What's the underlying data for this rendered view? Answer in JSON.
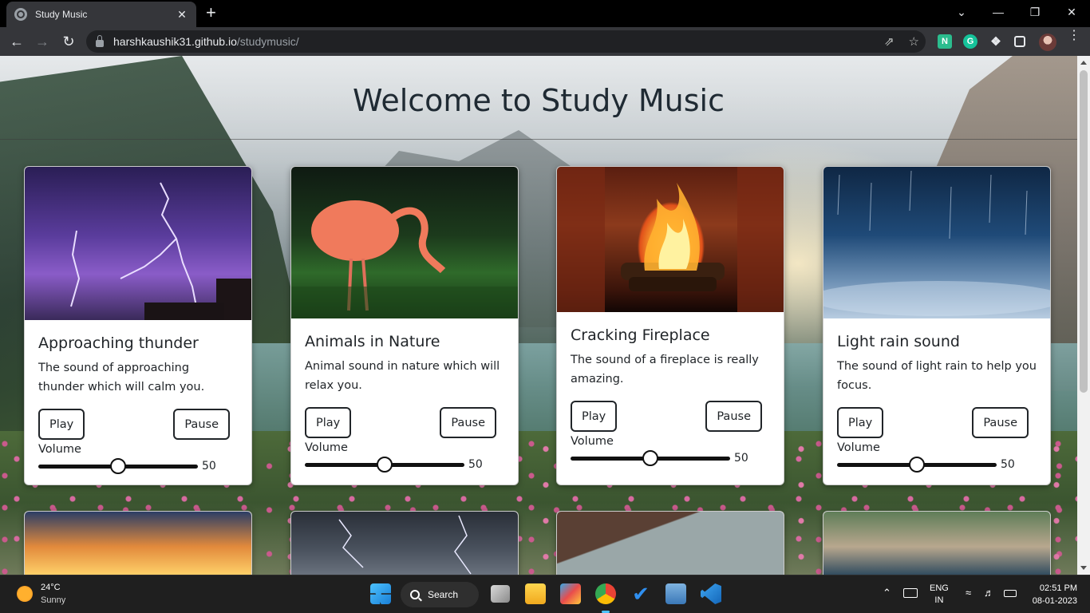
{
  "browser": {
    "tab_title": "Study Music",
    "tab_close": "✕",
    "new_tab": "+",
    "url_host": "harshkaushik31.github.io",
    "url_path": "/studymusic/",
    "extensions": [
      {
        "name": "notion-web-clipper",
        "glyph": "N",
        "color": "#2bbd8e"
      },
      {
        "name": "grammarly",
        "glyph": "G",
        "color": "#15c39a"
      }
    ]
  },
  "page": {
    "title": "Welcome to Study Music",
    "cards": [
      {
        "title": "Approaching thunder",
        "text": "The sound of approaching thunder which will calm you.",
        "play": "Play",
        "pause": "Pause",
        "volume_label": "Volume",
        "volume": 50
      },
      {
        "title": "Animals in Nature",
        "text": "Animal sound in nature which will relax you.",
        "play": "Play",
        "pause": "Pause",
        "volume_label": "Volume",
        "volume": 50
      },
      {
        "title": "Cracking Fireplace",
        "text": "The sound of a fireplace is really amazing.",
        "play": "Play",
        "pause": "Pause",
        "volume_label": "Volume",
        "volume": 50
      },
      {
        "title": "Light rain sound",
        "text": "The sound of light rain to help you focus.",
        "play": "Play",
        "pause": "Pause",
        "volume_label": "Volume",
        "volume": 50
      }
    ]
  },
  "taskbar": {
    "weather_temp": "24°C",
    "weather_desc": "Sunny",
    "search_label": "Search",
    "lang_top": "ENG",
    "lang_bottom": "IN",
    "time": "02:51 PM",
    "date": "08-01-2023"
  }
}
